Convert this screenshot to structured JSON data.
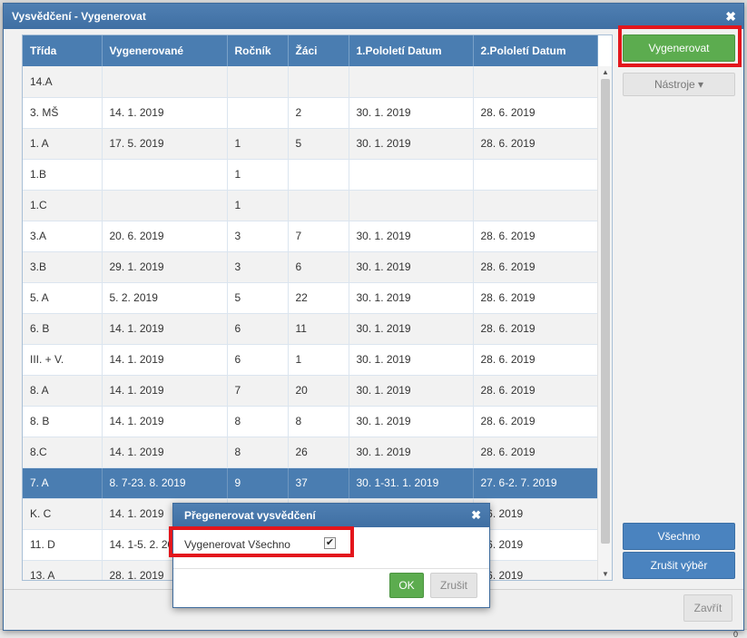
{
  "dialog": {
    "title": "Vysvědčení - Vygenerovat",
    "close_glyph": "✖"
  },
  "table": {
    "columns": [
      "Třída",
      "Vygenerované",
      "Ročník",
      "Žáci",
      "1.Pololetí Datum",
      "2.Pololetí Datum"
    ],
    "rows": [
      [
        "14.A",
        "",
        "",
        "",
        "",
        ""
      ],
      [
        "3. MŠ",
        "14. 1. 2019",
        "",
        "2",
        "30. 1. 2019",
        "28. 6. 2019"
      ],
      [
        "1. A",
        "17. 5. 2019",
        "1",
        "5",
        "30. 1. 2019",
        "28. 6. 2019"
      ],
      [
        "1.B",
        "",
        "1",
        "",
        "",
        ""
      ],
      [
        "1.C",
        "",
        "1",
        "",
        "",
        ""
      ],
      [
        "3.A",
        "20. 6. 2019",
        "3",
        "7",
        "30. 1. 2019",
        "28. 6. 2019"
      ],
      [
        "3.B",
        "29. 1. 2019",
        "3",
        "6",
        "30. 1. 2019",
        "28. 6. 2019"
      ],
      [
        "5. A",
        "5. 2. 2019",
        "5",
        "22",
        "30. 1. 2019",
        "28. 6. 2019"
      ],
      [
        "6. B",
        "14. 1. 2019",
        "6",
        "11",
        "30. 1. 2019",
        "28. 6. 2019"
      ],
      [
        "III. + V.",
        "14. 1. 2019",
        "6",
        "1",
        "30. 1. 2019",
        "28. 6. 2019"
      ],
      [
        "8. A",
        "14. 1. 2019",
        "7",
        "20",
        "30. 1. 2019",
        "28. 6. 2019"
      ],
      [
        "8. B",
        "14. 1. 2019",
        "8",
        "8",
        "30. 1. 2019",
        "28. 6. 2019"
      ],
      [
        "8.C",
        "14. 1. 2019",
        "8",
        "26",
        "30. 1. 2019",
        "28. 6. 2019"
      ],
      [
        "7. A",
        "8. 7-23. 8. 2019",
        "9",
        "37",
        "30. 1-31. 1. 2019",
        "27. 6-2. 7. 2019"
      ],
      [
        "K. C",
        "14. 1. 2019",
        "",
        "",
        "",
        ". 6. 2019"
      ],
      [
        "11. D",
        "14. 1-5. 2. 20",
        "",
        "",
        "",
        ". 6. 2019"
      ],
      [
        "13. A",
        "28. 1. 2019",
        "",
        "",
        "",
        ". 6. 2019"
      ]
    ],
    "selected_row_index": 13
  },
  "buttons": {
    "generate": "Vygenerovat",
    "tools": "Nástroje ▾",
    "all": "Všechno",
    "deselect": "Zrušit výběr",
    "close": "Zavřít"
  },
  "scrollbar": {
    "up_glyph": "▲",
    "down_glyph": "▼"
  },
  "background": {
    "corner_digit": "0"
  },
  "modal": {
    "title": "Přegenerovat vysvědčení",
    "close_glyph": "✖",
    "checkbox_label": "Vygenerovat Všechno",
    "checkbox_checked": true,
    "check_glyph": "✔",
    "ok_label": "OK",
    "cancel_label": "Zrušit"
  },
  "colors": {
    "title_bar": "#4a7db1",
    "primary_green": "#5cac4f",
    "highlight_red": "#e3161c",
    "selected_row": "#4a7db1"
  }
}
